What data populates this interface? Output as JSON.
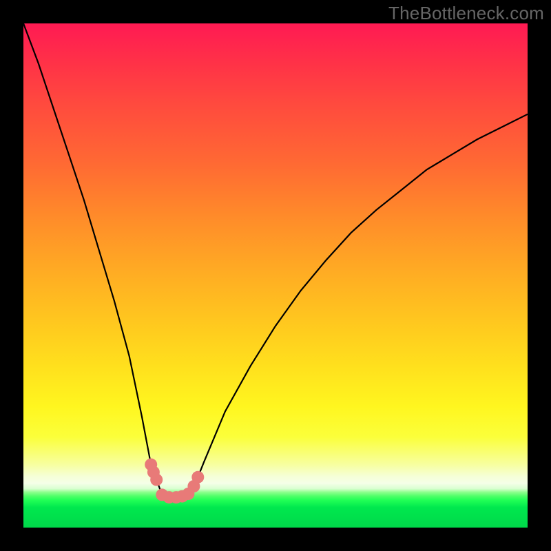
{
  "watermark": "TheBottleneck.com",
  "colors": {
    "page_bg": "#000000",
    "watermark": "#666666",
    "curve": "#000000",
    "marker_fill": "#e87a78",
    "marker_stroke": "#c94f4d",
    "gradient_top": "#ff1a53",
    "gradient_mid": "#ffe01d",
    "gradient_bottom": "#00d84a"
  },
  "chart_data": {
    "type": "line",
    "title": "",
    "xlabel": "",
    "ylabel": "",
    "xlim": [
      0,
      100
    ],
    "ylim": [
      0,
      100
    ],
    "grid": false,
    "legend": false,
    "note": "Values estimated from pixel positions; y is 'bottleneck %' (0 = green/good, 100 = red/bad). Curve has a V-shaped minimum around x≈30 and rises toward both ends.",
    "series": [
      {
        "name": "bottleneck-curve",
        "x": [
          0,
          3,
          6,
          9,
          12,
          15,
          18,
          21,
          23.5,
          25.3,
          25.8,
          26.4,
          27.5,
          28.9,
          30.3,
          31.5,
          32.7,
          33.8,
          34.6,
          35.8,
          40,
          45,
          50,
          55,
          60,
          65,
          70,
          75,
          80,
          85,
          90,
          95,
          100
        ],
        "y": [
          100,
          92,
          83,
          74,
          65,
          55,
          45,
          34,
          22,
          12.5,
          11,
          9.5,
          6.5,
          6,
          6,
          6.2,
          6.7,
          8.2,
          10,
          13,
          23,
          32,
          40,
          47,
          53,
          58.5,
          63,
          67,
          71,
          74,
          77,
          79.5,
          82
        ]
      },
      {
        "name": "markers",
        "x": [
          25.3,
          25.8,
          26.4,
          27.5,
          28.9,
          30.3,
          31.5,
          32.7,
          33.8,
          34.6
        ],
        "y": [
          12.5,
          11,
          9.5,
          6.5,
          6,
          6,
          6.2,
          6.7,
          8.2,
          10
        ]
      }
    ]
  }
}
